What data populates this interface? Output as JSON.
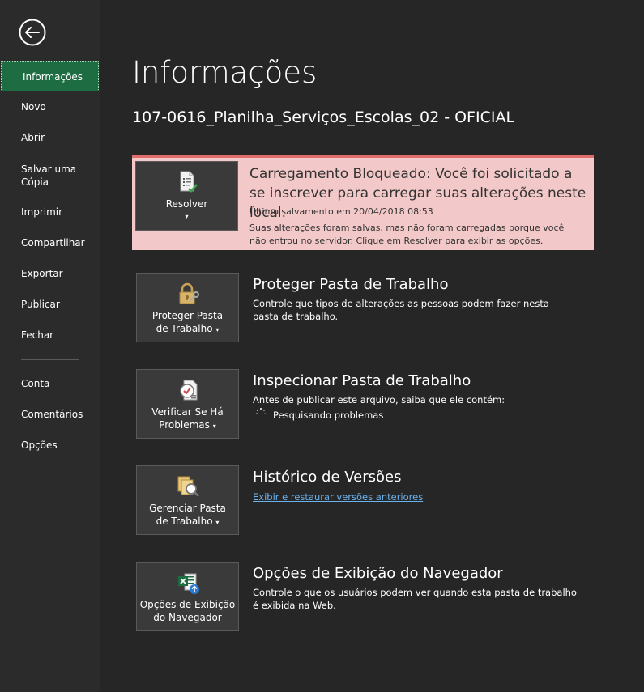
{
  "sidebar": {
    "items": [
      {
        "label": "Informações"
      },
      {
        "label": "Novo"
      },
      {
        "label": "Abrir"
      },
      {
        "label": "Salvar uma"
      },
      {
        "label": "Cópia"
      },
      {
        "label": "Imprimir"
      },
      {
        "label": "Compartilhar"
      },
      {
        "label": "Exportar"
      },
      {
        "label": "Publicar"
      },
      {
        "label": "Fechar"
      },
      {
        "label": "Conta"
      },
      {
        "label": "Comentários"
      },
      {
        "label": "Opções"
      }
    ]
  },
  "main": {
    "title": "Informações",
    "document_name": "107-0616_Planilha_Serviços_Escolas_02 - OFICIAL",
    "alert": {
      "button_label": "Resolver",
      "title": "Carregamento Bloqueado: Você foi solicitado a se inscrever para carregar suas alterações neste local.",
      "last_saved": "Último salvamento em 20/04/2018 08:53",
      "description": "Suas alterações foram salvas, mas não foram carregadas porque você não entrou no servidor. Clique em Resolver para exibir as opções."
    },
    "sections": [
      {
        "button_line1": "Proteger Pasta",
        "button_line2": "de Trabalho",
        "title": "Proteger Pasta de Trabalho",
        "description": "Controle que tipos de alterações as pessoas podem fazer nesta pasta de trabalho."
      },
      {
        "button_line1": "Verificar Se Há",
        "button_line2": "Problemas",
        "title": "Inspecionar Pasta de Trabalho",
        "description": "Antes de publicar este arquivo, saiba que ele contém:",
        "status": "Pesquisando problemas"
      },
      {
        "button_line1": "Gerenciar Pasta",
        "button_line2": "de Trabalho",
        "title": "Histórico de Versões",
        "link": "Exibir e restaurar versões anteriores"
      },
      {
        "button_line1": "Opções de Exibição",
        "button_line2": "do Navegador",
        "title": "Opções de Exibição do Navegador",
        "description": "Controle o que os usuários podem ver quando esta pasta de trabalho é exibida na Web."
      }
    ]
  },
  "colors": {
    "selected_nav": "#1d6c42",
    "alert_bg": "#f3c8c8",
    "alert_border": "#e06c6c",
    "link": "#6ab3ef"
  }
}
